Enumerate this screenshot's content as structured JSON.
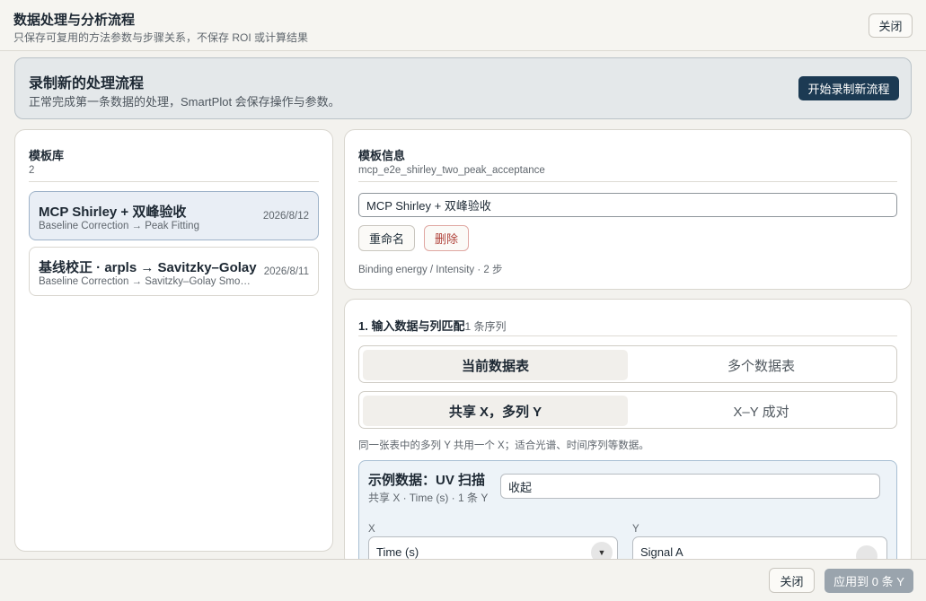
{
  "header": {
    "title": "数据处理与分析流程",
    "subtitle": "只保存可复用的方法参数与步骤关系，不保存 ROI 或计算结果",
    "close_label": "关闭"
  },
  "banner": {
    "title": "录制新的处理流程",
    "subtitle": "正常完成第一条数据的处理，SmartPlot 会保存操作与参数。",
    "record_button": "开始录制新流程"
  },
  "library": {
    "title": "模板库",
    "count": "2",
    "templates": [
      {
        "name": "MCP Shirley + 双峰验收",
        "steps": "Baseline Correction → Peak Fitting",
        "date": "2026/8/12"
      },
      {
        "name": "基线校正 · arpls → Savitzky–Golay",
        "steps": "Baseline Correction → Savitzky–Golay Smoothing",
        "date": "2026/8/11"
      }
    ]
  },
  "info": {
    "title": "模板信息",
    "id": "mcp_e2e_shirley_two_peak_acceptance",
    "name_value": "MCP Shirley + 双峰验收",
    "rename_label": "重命名",
    "delete_label": "删除",
    "meta": "Binding energy / Intensity · 2 步"
  },
  "step1": {
    "title": "1. 输入数据与列匹配",
    "count": "1 条序列",
    "source_tabs": [
      "当前数据表",
      "多个数据表"
    ],
    "mode_tabs": [
      "共享 X，多列 Y",
      "X–Y 成对"
    ],
    "hint": "同一张表中的多列 Y 共用一个 X；适合光谱、时间序列等数据。",
    "sample": {
      "title": "示例数据：UV 扫描",
      "sub": "共享 X · Time (s) · 1 条 Y",
      "collapse_value": "收起",
      "x_label": "X",
      "y_label": "Y",
      "x_value": "Time (s)",
      "y_value": "Signal A"
    }
  },
  "footer": {
    "close_label": "关闭",
    "apply_label": "应用到 0 条 Y"
  }
}
